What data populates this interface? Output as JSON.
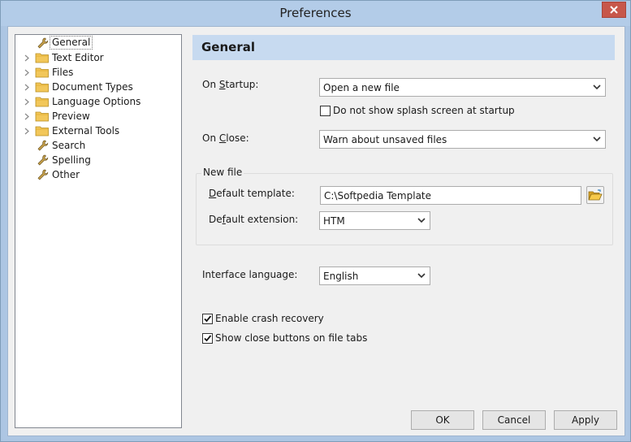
{
  "window": {
    "title": "Preferences"
  },
  "tree": {
    "items": [
      {
        "label": "General",
        "icon": "wrench-icon",
        "expandable": false,
        "selected": true
      },
      {
        "label": "Text Editor",
        "icon": "folder-icon",
        "expandable": true
      },
      {
        "label": "Files",
        "icon": "folder-icon",
        "expandable": true
      },
      {
        "label": "Document Types",
        "icon": "folder-icon",
        "expandable": true
      },
      {
        "label": "Language Options",
        "icon": "folder-icon",
        "expandable": true
      },
      {
        "label": "Preview",
        "icon": "folder-icon",
        "expandable": true
      },
      {
        "label": "External Tools",
        "icon": "folder-icon",
        "expandable": true
      },
      {
        "label": "Search",
        "icon": "wrench-icon",
        "expandable": false
      },
      {
        "label": "Spelling",
        "icon": "wrench-icon",
        "expandable": false
      },
      {
        "label": "Other",
        "icon": "wrench-icon",
        "expandable": false
      }
    ]
  },
  "panel": {
    "title": "General",
    "startup": {
      "label_pre": "On ",
      "label_key": "S",
      "label_post": "tartup:",
      "value": "Open a new file"
    },
    "splash": {
      "label": "Do not show splash screen at startup",
      "checked": false
    },
    "close": {
      "label_pre": "On ",
      "label_key": "C",
      "label_post": "lose:",
      "value": "Warn about unsaved files"
    },
    "new_file": {
      "group_label": "New file",
      "template_label_key": "D",
      "template_label_post": "efault template:",
      "template_value": "C:\\Softpedia Template",
      "extension_label_pre": "De",
      "extension_label_key": "f",
      "extension_label_post": "ault extension:",
      "extension_value": "HTM"
    },
    "interface_language": {
      "label": "Interface language:",
      "value": "English"
    },
    "crash_recovery": {
      "label": "Enable crash recovery",
      "checked": true
    },
    "close_buttons": {
      "label": "Show close buttons on file tabs",
      "checked": true
    }
  },
  "buttons": {
    "ok": "OK",
    "cancel": "Cancel",
    "apply": "Apply"
  },
  "colors": {
    "header_bg": "#c7daf0",
    "title_bar": "#b3cce8",
    "close_button": "#c7574a"
  }
}
